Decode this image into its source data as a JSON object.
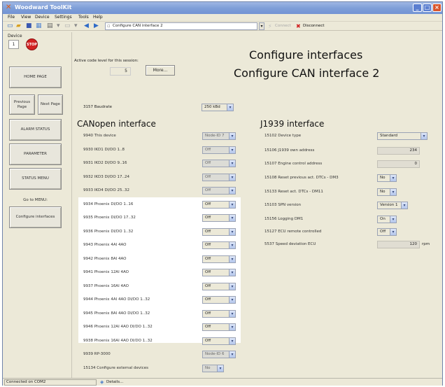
{
  "window": {
    "title": "Woodward ToolKit"
  },
  "menu": [
    "File",
    "View",
    "Device",
    "Settings",
    "Tools",
    "Help"
  ],
  "toolbar": {
    "address": "Configure CAN interface 2",
    "connect_label": "Connect",
    "disconnect_label": "Disconnect"
  },
  "device": {
    "label": "Device",
    "number": "1",
    "stop_label": "STOP"
  },
  "nav": {
    "home": "HOME PAGE",
    "previous": "Previous Page",
    "next": "Next Page",
    "alarm": "ALARM STATUS",
    "parameter": "PARAMETER",
    "status_menu": "STATUS MENU",
    "goto": "Go to MENU:",
    "configure": "Configure interfaces"
  },
  "session": {
    "label": "Active code level for this session:",
    "value": "5",
    "more": "More..."
  },
  "titles": {
    "t1": "Configure interfaces",
    "t2": "Configure CAN interface 2"
  },
  "baud": {
    "label": "3157 Baudrate",
    "value": "250 kBd"
  },
  "canopen": {
    "heading": "CANopen interface",
    "rows": [
      {
        "label": "9940 This device",
        "value": "Node-ID 7",
        "grey": true
      },
      {
        "label": "9930 IKD1 DI/DO 1..8",
        "value": "Off",
        "grey": true
      },
      {
        "label": "9931 IKD2 DI/DO 9..16",
        "value": "Off",
        "grey": true
      },
      {
        "label": "9932 IKD3 DI/DO 17..24",
        "value": "Off",
        "grey": true
      },
      {
        "label": "9933 IKD4 DI/DO 25..32",
        "value": "Off",
        "grey": true
      },
      {
        "label": "9934 Phoenix DI/DO 1..16",
        "value": "Off",
        "grey": false
      },
      {
        "label": "9935 Phoenix DI/DO 17..32",
        "value": "Off",
        "grey": false
      },
      {
        "label": "9936 Phoenix DI/DO 1..32",
        "value": "Off",
        "grey": false
      },
      {
        "label": "9943 Phoenix 4AI 4AO",
        "value": "Off",
        "grey": false
      },
      {
        "label": "9942 Phoenix 8AI 4AO",
        "value": "Off",
        "grey": false
      },
      {
        "label": "9941 Phoenix 12AI 4AO",
        "value": "Off",
        "grey": false
      },
      {
        "label": "9937 Phoenix 16AI 4AO",
        "value": "Off",
        "grey": false
      },
      {
        "label": "9944 Phoenix 4AI 4AO DI/DO 1..32",
        "value": "Off",
        "grey": false
      },
      {
        "label": "9945 Phoenix 8AI 4AO DI/DO 1..32",
        "value": "Off",
        "grey": false
      },
      {
        "label": "9946 Phoenix 12AI 4AO DI/DO 1..32",
        "value": "Off",
        "grey": false
      },
      {
        "label": "9938 Phoenix 16AI 4AO DI/DO 1..32",
        "value": "Off",
        "grey": false
      },
      {
        "label": "9939 RP-3000",
        "value": "Node-ID 6",
        "grey": true
      },
      {
        "label": "15134 Configure external devices",
        "value": "No",
        "grey": true
      }
    ]
  },
  "j1939": {
    "heading": "J1939 interface",
    "rows": [
      {
        "label": "15102 Device type",
        "value": "Standard",
        "kind": "select"
      },
      {
        "label": "15106 J1939 own address",
        "value": "234",
        "kind": "number"
      },
      {
        "label": "15107 Engine control address",
        "value": "0",
        "kind": "number"
      },
      {
        "label": "15108 Reset previous act. DTCs - DM3",
        "value": "No",
        "kind": "select"
      },
      {
        "label": "15133 Reset act. DTCs - DM11",
        "value": "No",
        "kind": "select"
      },
      {
        "label": "15103 SPN version",
        "value": "Version 1",
        "kind": "select"
      },
      {
        "label": "15156 Logging DM1",
        "value": "On",
        "kind": "select"
      },
      {
        "label": "15127 ECU remote controlled",
        "value": "Off",
        "kind": "select"
      },
      {
        "label": "5537 Speed deviation ECU",
        "value": "120",
        "kind": "number",
        "unit": "rpm"
      }
    ]
  },
  "status": {
    "connection": "Connected on COM2",
    "details": "Details..."
  }
}
